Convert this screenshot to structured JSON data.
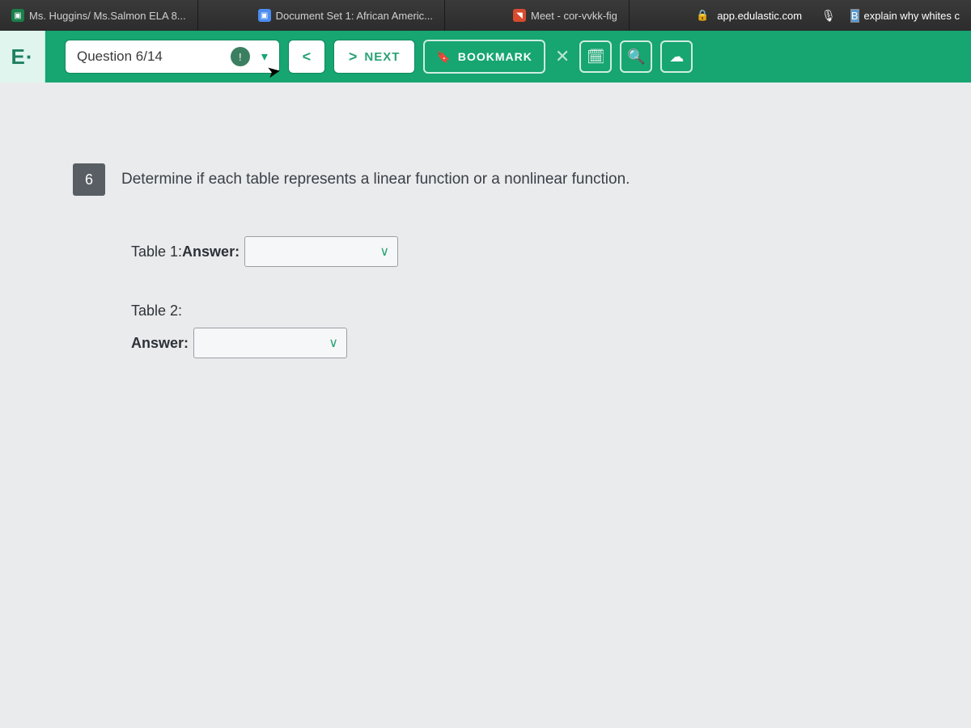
{
  "browser": {
    "tabs": [
      {
        "label": "Ms. Huggins/ Ms.Salmon ELA 8..."
      },
      {
        "label": "Document Set 1: African Americ..."
      },
      {
        "label": "Meet - cor-vvkk-fig"
      },
      {
        "label": "explain why whites c"
      }
    ],
    "url_host": "app.edulastic.com"
  },
  "toolbar": {
    "brand": "E·",
    "question_label": "Question 6/14",
    "prev_symbol": "<",
    "next_symbol": ">",
    "next_label": "NEXT",
    "bookmark_label": "BOOKMARK"
  },
  "question": {
    "number": "6",
    "prompt": "Determine if each table represents a linear function or a nonlinear function.",
    "answers": [
      {
        "label_prefix": "Table 1:",
        "label_bold": "Answer:"
      },
      {
        "label_line1": "Table 2:",
        "label_line2": "Answer:"
      }
    ]
  }
}
